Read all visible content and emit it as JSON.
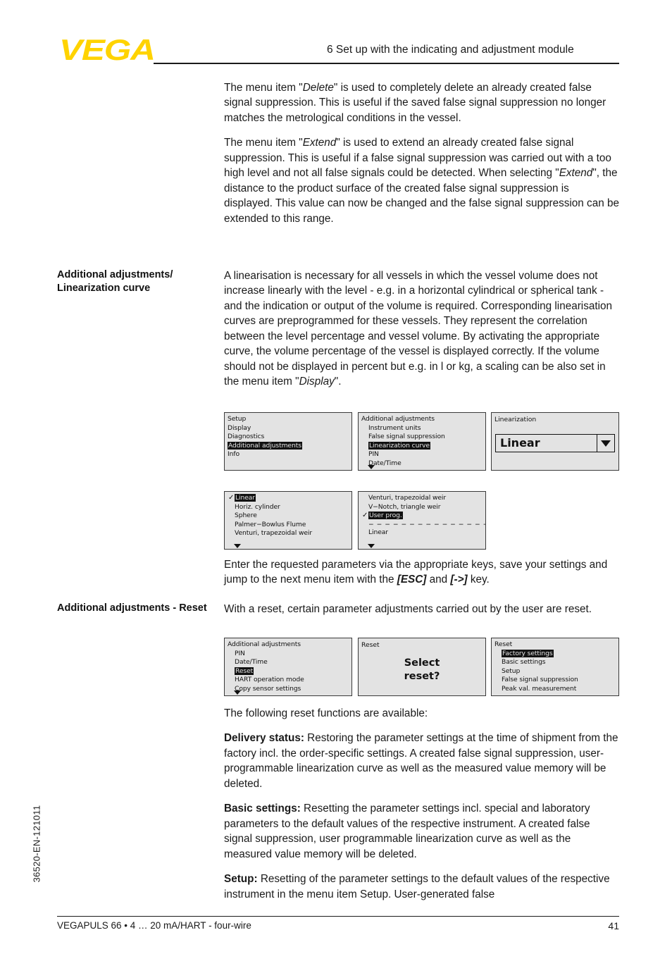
{
  "header": {
    "logo_text": "VEGA",
    "logo_color": "#FFD300",
    "chapter_title": "6 Set up with the indicating and adjustment module"
  },
  "footer": {
    "document_line": "VEGAPULS 66 • 4 … 20 mA/HART - four-wire",
    "page_number": "41",
    "side_code": "36520-EN-121011"
  },
  "body": {
    "para_delete": {
      "t1": "The menu item \"",
      "em1": "Delete",
      "t2": "\" is used to completely delete an already created false signal suppression. This is useful if the saved false signal suppression no longer matches the metrological conditions in the vessel."
    },
    "para_extend": {
      "t1": "The menu item \"",
      "em1": "Extend",
      "t2": "\" is used to extend an already created false signal suppression. This is useful if a false signal suppression was carried out with a too high level and not all false signals could be detected. When selecting \"",
      "em2": "Extend",
      "t3": "\", the distance to the product surface of the created false signal suppression is displayed. This value can now be changed and the false signal suppression can be extended to this range."
    },
    "margin_note_linearization": "Additional adjustments/ Linearization curve",
    "para_linearisation": {
      "t1": "A linearisation is necessary for all vessels in which the vessel volume does not increase linearly with the level - e.g. in a horizontal cylindrical or spherical tank - and the indication or output of the volume is required. Corresponding linearisation curves are preprogrammed for these vessels. They represent the correlation between the level percentage and vessel volume. By activating the appropriate curve, the volume percentage of the vessel is displayed correctly. If the volume should not be displayed in percent but e.g. in l or kg, a scaling can be also set in the menu item \"",
      "em1": "Display",
      "t2": "\"."
    },
    "para_enter_params": {
      "t1": "Enter the requested parameters via the appropriate keys, save your settings and jump to the next menu item with the ",
      "kb1": "[ESC]",
      "t2": " and ",
      "kb2": "[->]",
      "t3": " key."
    },
    "margin_note_reset": "Additional adjustments - Reset",
    "para_reset_intro": "With a reset, certain parameter adjustments carried out by the user are reset.",
    "para_reset_functions": "The following reset functions are available:",
    "para_delivery_status": {
      "label": "Delivery status:",
      "text": " Restoring the parameter settings at the time of shipment from the factory incl. the order-specific settings. A created false signal suppression, user-programmable linearization curve as well as the measured value memory will be deleted."
    },
    "para_basic_settings": {
      "label": "Basic settings:",
      "text": " Resetting the parameter settings incl. special and laboratory parameters to the default values of the respective instrument. A created false signal suppression, user programmable linearization curve as well as the measured value memory will be deleted."
    },
    "para_setup": {
      "label": "Setup:",
      "text": " Resetting of the parameter settings to the default values of the respective instrument in the menu item Setup. User-generated false"
    }
  },
  "lcd_screens": {
    "row1": [
      {
        "name": "main-menu",
        "type": "list",
        "title": null,
        "lines": [
          {
            "text": "Setup",
            "highlight": false,
            "check": false,
            "indent": false
          },
          {
            "text": "Display",
            "highlight": false,
            "check": false,
            "indent": false
          },
          {
            "text": "Diagnostics",
            "highlight": false,
            "check": false,
            "indent": false
          },
          {
            "text": "Additional adjustments",
            "highlight": true,
            "check": false,
            "indent": false
          },
          {
            "text": "Info",
            "highlight": false,
            "check": false,
            "indent": false
          }
        ],
        "scroll_arrow": false
      },
      {
        "name": "additional-adjustments-menu",
        "type": "list",
        "title": "Additional adjustments",
        "lines": [
          {
            "text": "Instrument units",
            "highlight": false,
            "check": false,
            "indent": true
          },
          {
            "text": "False signal suppression",
            "highlight": false,
            "check": false,
            "indent": true
          },
          {
            "text": "Linearization curve",
            "highlight": true,
            "check": false,
            "indent": true
          },
          {
            "text": "PIN",
            "highlight": false,
            "check": false,
            "indent": true
          },
          {
            "text": "Date/Time",
            "highlight": false,
            "check": false,
            "indent": true
          }
        ],
        "scroll_arrow": true
      },
      {
        "name": "linearization-dropdown",
        "type": "dropdown",
        "title": "Linearization",
        "value": "Linear",
        "caret": "chevron-down"
      }
    ],
    "row2": [
      {
        "name": "linearization-curve-list-1",
        "type": "list",
        "title": null,
        "lines": [
          {
            "text": "Linear",
            "highlight": true,
            "check": true,
            "indent": true
          },
          {
            "text": "Horiz. cylinder",
            "highlight": false,
            "check": false,
            "indent": true
          },
          {
            "text": "Sphere",
            "highlight": false,
            "check": false,
            "indent": true
          },
          {
            "text": "Palmer−Bowlus Flume",
            "highlight": false,
            "check": false,
            "indent": true
          },
          {
            "text": "Venturi, trapezoidal weir",
            "highlight": false,
            "check": false,
            "indent": true
          }
        ],
        "scroll_arrow": true
      },
      {
        "name": "linearization-curve-list-2",
        "type": "list",
        "title": null,
        "lines": [
          {
            "text": "Venturi, trapezoidal weir",
            "highlight": false,
            "check": false,
            "indent": true
          },
          {
            "text": "V−Notch, triangle weir",
            "highlight": false,
            "check": false,
            "indent": true
          },
          {
            "text": "User prog.",
            "highlight": true,
            "check": true,
            "indent": true
          },
          {
            "text": "− − − − − − − − − − − − − − −",
            "highlight": false,
            "check": false,
            "indent": true,
            "divider": true
          },
          {
            "text": "Linear",
            "highlight": false,
            "check": false,
            "indent": true
          }
        ],
        "scroll_arrow": true
      }
    ],
    "row3": [
      {
        "name": "additional-adjustments-reset-menu",
        "type": "list",
        "title": "Additional adjustments",
        "lines": [
          {
            "text": "PIN",
            "highlight": false,
            "check": false,
            "indent": true
          },
          {
            "text": "Date/Time",
            "highlight": false,
            "check": false,
            "indent": true
          },
          {
            "text": "Reset",
            "highlight": true,
            "check": false,
            "indent": true
          },
          {
            "text": "HART operation mode",
            "highlight": false,
            "check": false,
            "indent": true
          },
          {
            "text": "Copy sensor settings",
            "highlight": false,
            "check": false,
            "indent": true
          }
        ],
        "scroll_arrow": true
      },
      {
        "name": "reset-prompt",
        "type": "prompt",
        "title": "Reset",
        "prompt_line1": "Select",
        "prompt_line2": "reset?"
      },
      {
        "name": "reset-options-menu",
        "type": "list",
        "title": "Reset",
        "lines": [
          {
            "text": "Factory settings",
            "highlight": true,
            "check": false,
            "indent": true
          },
          {
            "text": "Basic settings",
            "highlight": false,
            "check": false,
            "indent": true
          },
          {
            "text": "Setup",
            "highlight": false,
            "check": false,
            "indent": true
          },
          {
            "text": "False signal suppression",
            "highlight": false,
            "check": false,
            "indent": true
          },
          {
            "text": "Peak val. measurement",
            "highlight": false,
            "check": false,
            "indent": true
          }
        ],
        "scroll_arrow": false
      }
    ]
  }
}
